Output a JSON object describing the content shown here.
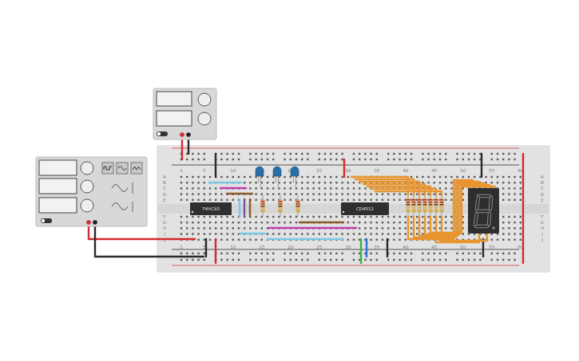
{
  "power_supply": {
    "switch_on": false
  },
  "function_generator": {
    "switch_on": false,
    "waveform_buttons": [
      {
        "kind": "square",
        "selected": false
      },
      {
        "kind": "sine",
        "selected": false
      },
      {
        "kind": "triangle",
        "selected": false
      }
    ]
  },
  "breadboard": {
    "column_labels": [
      "1",
      "5",
      "10",
      "15",
      "20",
      "25",
      "30",
      "35",
      "40",
      "45",
      "50",
      "55",
      "60"
    ],
    "row_labels": [
      "A",
      "B",
      "C",
      "D",
      "E",
      "F",
      "G",
      "H",
      "I",
      "J"
    ]
  },
  "chips": [
    {
      "label": "74HC93"
    },
    {
      "label": "CD4511"
    }
  ],
  "leds": [
    {
      "lit": false
    },
    {
      "lit": false
    },
    {
      "lit": false
    }
  ],
  "display": {
    "segments": [
      {
        "lit": false
      },
      {
        "lit": false
      },
      {
        "lit": false
      },
      {
        "lit": false
      },
      {
        "lit": false
      },
      {
        "lit": false
      },
      {
        "lit": false
      }
    ],
    "decimal_point": {
      "lit": false
    }
  },
  "wires": [
    {
      "color": "#d42a2a"
    },
    {
      "color": "#2a2a2a"
    },
    {
      "color": "#d42a2a"
    },
    {
      "color": "#2a2a2a"
    },
    {
      "color": "#7cc8e6"
    },
    {
      "color": "#c23fb0"
    },
    {
      "color": "#8b5a2b"
    },
    {
      "color": "#7cc8e6"
    },
    {
      "color": "#7b4fa0"
    },
    {
      "color": "#8b5a2b"
    },
    {
      "color": "#c23fb0"
    },
    {
      "color": "#8b5a2b"
    },
    {
      "color": "#7cc8e6"
    },
    {
      "color": "#7cc8e6"
    },
    {
      "color": "#d42a2a"
    },
    {
      "color": "#2a2a2a"
    },
    {
      "color": "#d42a2a"
    },
    {
      "color": "#2a2a2a"
    },
    {
      "color": "#3fae49"
    },
    {
      "color": "#2f6fd6"
    },
    {
      "color": "#2a2a2a"
    },
    {
      "color": "#2a2a2a"
    },
    {
      "color": "#2a2a2a"
    },
    {
      "color": "#d42a2a"
    },
    {
      "color": "#e8952f"
    },
    {
      "color": "#e8952f"
    },
    {
      "color": "#e8952f"
    },
    {
      "color": "#e8952f"
    },
    {
      "color": "#e8952f"
    },
    {
      "color": "#e8952f"
    },
    {
      "color": "#e8952f"
    },
    {
      "color": "#e8952f"
    },
    {
      "color": "#e8952f"
    },
    {
      "color": "#e8952f"
    },
    {
      "color": "#e8952f"
    },
    {
      "color": "#e8952f"
    },
    {
      "color": "#e8952f"
    },
    {
      "color": "#e8952f"
    }
  ]
}
